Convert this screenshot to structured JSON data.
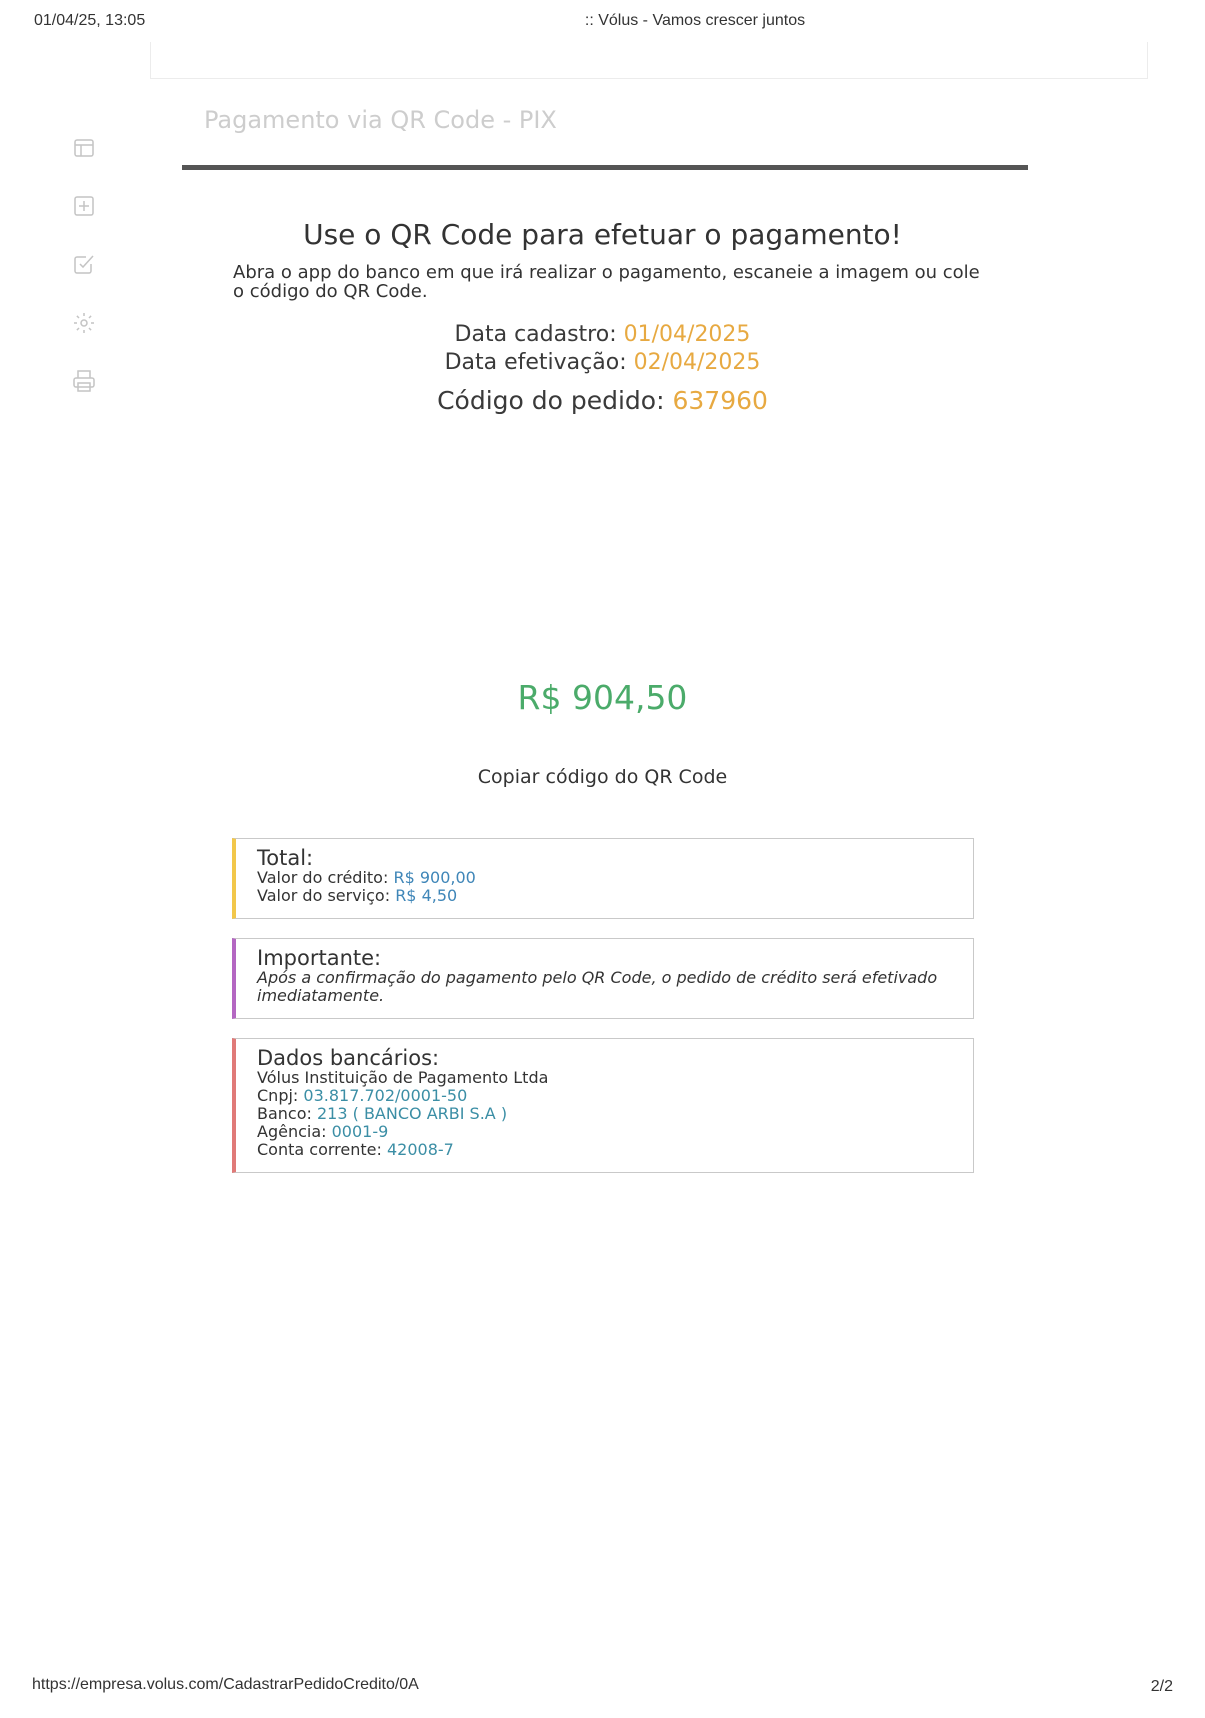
{
  "browser_print": {
    "date_time": "01/04/25, 13:05",
    "window_title": ":: Vólus - Vamos crescer juntos",
    "url": "https://empresa.volus.com/CadastrarPedidoCredito/0A",
    "page_number": "2/2"
  },
  "sidebar": {
    "items": [
      {
        "icon": "dashboard-icon"
      },
      {
        "icon": "add-square-icon"
      },
      {
        "icon": "checkbox-icon"
      },
      {
        "icon": "gear-icon"
      },
      {
        "icon": "printer-icon"
      }
    ]
  },
  "page": {
    "title": "Pagamento via QR Code - PIX",
    "heading": "Use o QR Code para efetuar o pagamento!",
    "instructions": "Abra o app do banco em que irá realizar o pagamento, escaneie a imagem ou cole o código do QR Code."
  },
  "order": {
    "data_cadastro_label": "Data cadastro:",
    "data_cadastro": "01/04/2025",
    "data_efetivacao_label": "Data efetivação:",
    "data_efetivacao": "02/04/2025",
    "codigo_label": "Código do pedido:",
    "codigo": "637960"
  },
  "payment": {
    "amount": "R$ 904,50",
    "copy_label": "Copiar código do QR Code"
  },
  "total_box": {
    "title": "Total:",
    "credito_label": "Valor do crédito:",
    "credito": "R$ 900,00",
    "servico_label": "Valor do serviço:",
    "servico": "R$ 4,50"
  },
  "important_box": {
    "title": "Importante:",
    "text": "Após a confirmação do pagamento pelo QR Code, o pedido de crédito será efetivado imediatamente."
  },
  "bank_box": {
    "title": "Dados bancários:",
    "company": "Vólus Instituição de Pagamento Ltda",
    "cnpj_label": "Cnpj:",
    "cnpj": "03.817.702/0001-50",
    "banco_label": "Banco:",
    "banco": "213 ( BANCO ARBI S.A )",
    "agencia_label": "Agência:",
    "agencia": "0001-9",
    "conta_label": "Conta corrente:",
    "conta": "42008-7"
  },
  "colors": {
    "accent_orange": "#e7a941",
    "amount_green": "#4bab6a",
    "value_blue": "#3f86b8",
    "total_border": "#f2c74a",
    "important_border": "#b467c2",
    "bank_border": "#e07a78"
  }
}
